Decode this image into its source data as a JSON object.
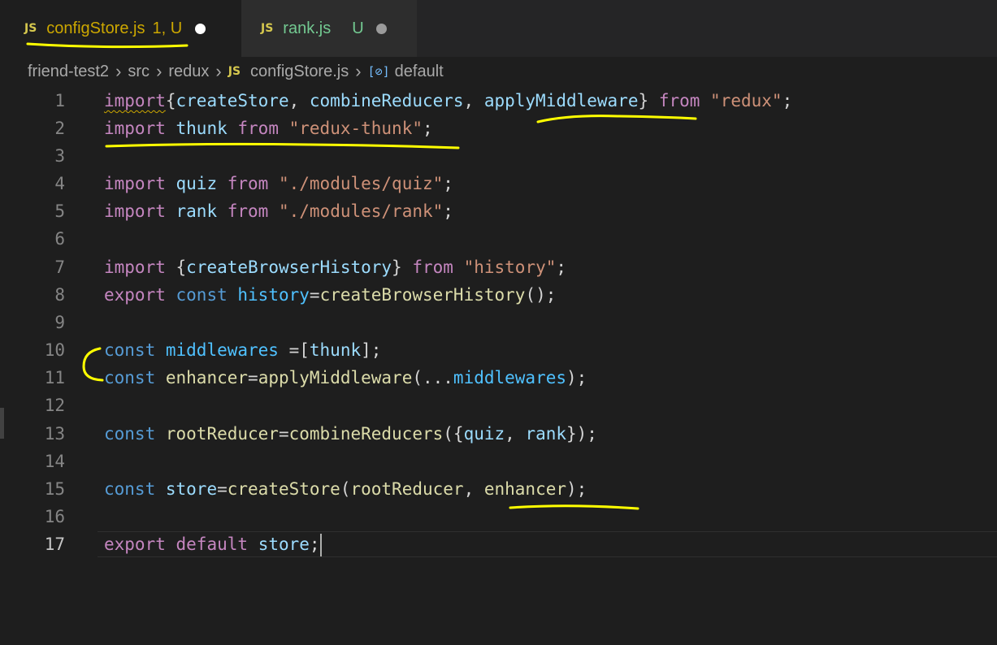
{
  "tabs": [
    {
      "icon": "JS",
      "name": "configStore.js",
      "status": "1, U",
      "active": true
    },
    {
      "icon": "JS",
      "name": "rank.js",
      "status": "U",
      "active": false
    }
  ],
  "breadcrumb": {
    "items": [
      "friend-test2",
      "src",
      "redux",
      "configStore.js",
      "default"
    ],
    "file_icon": "JS",
    "symbol_icon": "[⊘]"
  },
  "editor": {
    "line_numbers": [
      "1",
      "2",
      "3",
      "4",
      "5",
      "6",
      "7",
      "8",
      "9",
      "10",
      "11",
      "12",
      "13",
      "14",
      "15",
      "16",
      "17"
    ],
    "current_line": 17,
    "colors": {
      "keyword": "#c586c0",
      "storage": "#569cd6",
      "string": "#ce9178",
      "function": "#dcdcaa",
      "variable": "#9cdcfe",
      "constant": "#4fc1ff",
      "annotation": "#ffff00"
    }
  },
  "code": {
    "l1": {
      "import": "import",
      "ob": "{",
      "createStore": "createStore",
      "c1": ", ",
      "combineReducers": "combineReducers",
      "c2": ", ",
      "applyMiddleware": "applyMiddleware",
      "cb": "}",
      "sp": " ",
      "from": "from",
      "sp2": " ",
      "src": "\"redux\"",
      "semi": ";"
    },
    "l2": {
      "import": "import",
      "sp": " ",
      "thunk": "thunk",
      "sp2": " ",
      "from": "from",
      "sp3": " ",
      "src": "\"redux-thunk\"",
      "semi": ";"
    },
    "l4": {
      "import": "import",
      "sp": " ",
      "quiz": "quiz",
      "sp2": " ",
      "from": "from",
      "sp3": " ",
      "src": "\"./modules/quiz\"",
      "semi": ";"
    },
    "l5": {
      "import": "import",
      "sp": " ",
      "rank": "rank",
      "sp2": " ",
      "from": "from",
      "sp3": " ",
      "src": "\"./modules/rank\"",
      "semi": ";"
    },
    "l7": {
      "import": "import",
      "sp": " ",
      "ob": "{",
      "name": "createBrowserHistory",
      "cb": "}",
      "sp2": " ",
      "from": "from",
      "sp3": " ",
      "src": "\"history\"",
      "semi": ";"
    },
    "l8": {
      "export": "export",
      "sp": " ",
      "const": "const",
      "sp2": " ",
      "history": "history",
      "eq": "=",
      "call": "createBrowserHistory",
      "rest": "();"
    },
    "l10": {
      "const": "const",
      "sp": " ",
      "middlewares": "middlewares",
      "eq": " =[",
      "thunk": "thunk",
      "rest": "];"
    },
    "l11": {
      "const": "const",
      "sp": " ",
      "enhancer": "enhancer",
      "eq": "=",
      "call": "applyMiddleware",
      "op": "(...",
      "middlewares": "middlewares",
      "rest": ");"
    },
    "l13": {
      "const": "const",
      "sp": " ",
      "rootReducer": "rootReducer",
      "eq": "=",
      "call": "combineReducers",
      "op": "({",
      "quiz": "quiz",
      "c": ", ",
      "rank": "rank",
      "rest": "});"
    },
    "l15": {
      "const": "const",
      "sp": " ",
      "store": "store",
      "eq": "=",
      "call": "createStore",
      "op": "(",
      "rootReducer": "rootReducer",
      "c": ", ",
      "enhancer": "enhancer",
      "rest": ");"
    },
    "l17": {
      "export": "export",
      "sp": " ",
      "default": "default",
      "sp2": " ",
      "store": "store",
      "semi": ";"
    }
  }
}
